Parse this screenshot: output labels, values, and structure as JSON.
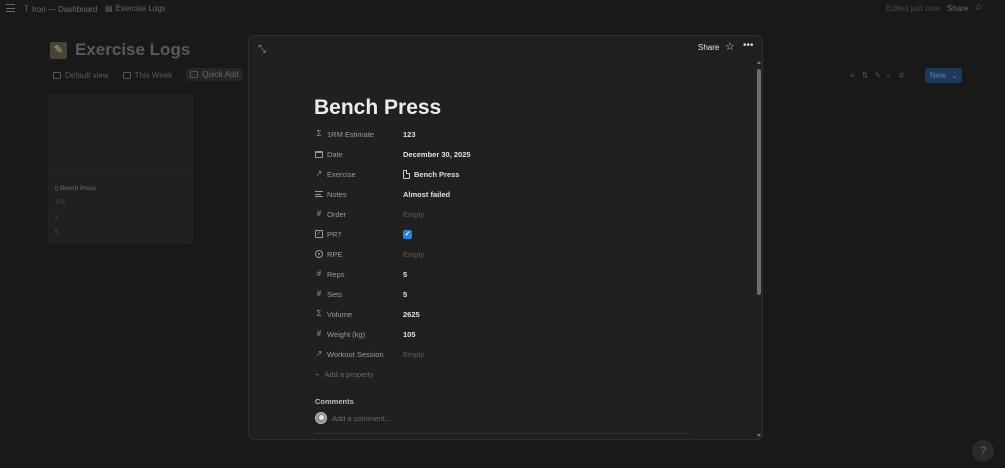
{
  "topbar": {
    "crumbs": [
      {
        "icon": "lift-icon",
        "label": "Iron — Dashboard"
      },
      {
        "icon": "page-icon",
        "label": "Exercise Logs"
      }
    ],
    "edited_label": "Edited just now",
    "share_label": "Share"
  },
  "database": {
    "title": "Exercise Logs",
    "views": [
      "Default view",
      "This Week",
      "Quick Add"
    ],
    "new_label": "New",
    "card": {
      "title": "Bench Press",
      "values": [
        "105",
        "5",
        "5"
      ]
    }
  },
  "modal": {
    "share_label": "Share",
    "title": "Bench Press",
    "properties": [
      {
        "icon": "sigma-icon",
        "name": "1RM Estimate",
        "value": "123",
        "empty": false
      },
      {
        "icon": "calendar-icon",
        "name": "Date",
        "value": "December 30, 2025",
        "empty": false
      },
      {
        "icon": "relation-arrow-icon",
        "name": "Exercise",
        "value": "Bench Press",
        "empty": false
      },
      {
        "icon": "text-lines-icon",
        "name": "Notes",
        "value": "Almost failed",
        "empty": false
      },
      {
        "icon": "hash-icon",
        "name": "Order",
        "value": "Empty",
        "empty": true
      },
      {
        "icon": "checkbox-icon",
        "name": "PR?",
        "value": "",
        "checked": true
      },
      {
        "icon": "select-circle-icon",
        "name": "RPE",
        "value": "Empty",
        "empty": true
      },
      {
        "icon": "hash-icon",
        "name": "Reps",
        "value": "5",
        "empty": false
      },
      {
        "icon": "hash-icon",
        "name": "Sets",
        "value": "5",
        "empty": false
      },
      {
        "icon": "sigma-icon",
        "name": "Volume",
        "value": "2625",
        "empty": false
      },
      {
        "icon": "hash-icon",
        "name": "Weight (kg)",
        "value": "105",
        "empty": false
      },
      {
        "icon": "relation-arrow-icon",
        "name": "Workout Session",
        "value": "Empty",
        "empty": true
      }
    ],
    "add_property_label": "Add a property",
    "comments_heading": "Comments",
    "comment_placeholder": "Add a comment..."
  },
  "colors": {
    "accent": "#2383e2",
    "modal_bg": "#202020",
    "page_bg": "#191919"
  }
}
